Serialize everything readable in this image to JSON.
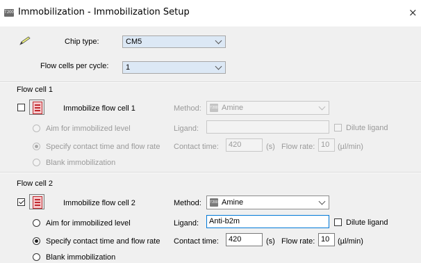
{
  "window": {
    "icon_text": "T200",
    "title": "Immobilization - Immobilization Setup",
    "close_glyph": "×"
  },
  "setup": {
    "chip_type_label": "Chip type:",
    "chip_type_value": "CM5",
    "flow_cells_label": "Flow cells per cycle:",
    "flow_cells_value": "1"
  },
  "flow_cell_1": {
    "group_label": "Flow cell 1",
    "immobilize_label": "Immobilize flow cell 1",
    "immobilize_checked": false,
    "method_label": "Method:",
    "method_value": "Amine",
    "method_icon_text": "T200",
    "ligand_label": "Ligand:",
    "ligand_value": "",
    "dilute_label": "Dilute ligand",
    "contact_time_label": "Contact time:",
    "contact_time_value": "420",
    "contact_time_unit": "(s)",
    "flow_rate_label": "Flow rate:",
    "flow_rate_value": "10",
    "flow_rate_unit": "(µl/min)",
    "options": [
      "Aim for immobilized level",
      "Specify contact time and flow rate",
      "Blank immobilization"
    ],
    "selected_option": 1
  },
  "flow_cell_2": {
    "group_label": "Flow cell 2",
    "immobilize_label": "Immobilize flow cell 2",
    "immobilize_checked": true,
    "method_label": "Method:",
    "method_value": "Amine",
    "method_icon_text": "T200",
    "ligand_label": "Ligand:",
    "ligand_value": "Anti-b2m",
    "dilute_label": "Dilute ligand",
    "contact_time_label": "Contact time:",
    "contact_time_value": "420",
    "contact_time_unit": "(s)",
    "flow_rate_label": "Flow rate:",
    "flow_rate_value": "10",
    "flow_rate_unit": "(µl/min)",
    "options": [
      "Aim for immobilized level",
      "Specify contact time and flow rate",
      "Blank immobilization"
    ],
    "selected_option": 1
  },
  "colors": {
    "panel_bg": "#f0f0f0",
    "focus_border": "#0078d7",
    "cell_icon_red": "#c0282d"
  }
}
